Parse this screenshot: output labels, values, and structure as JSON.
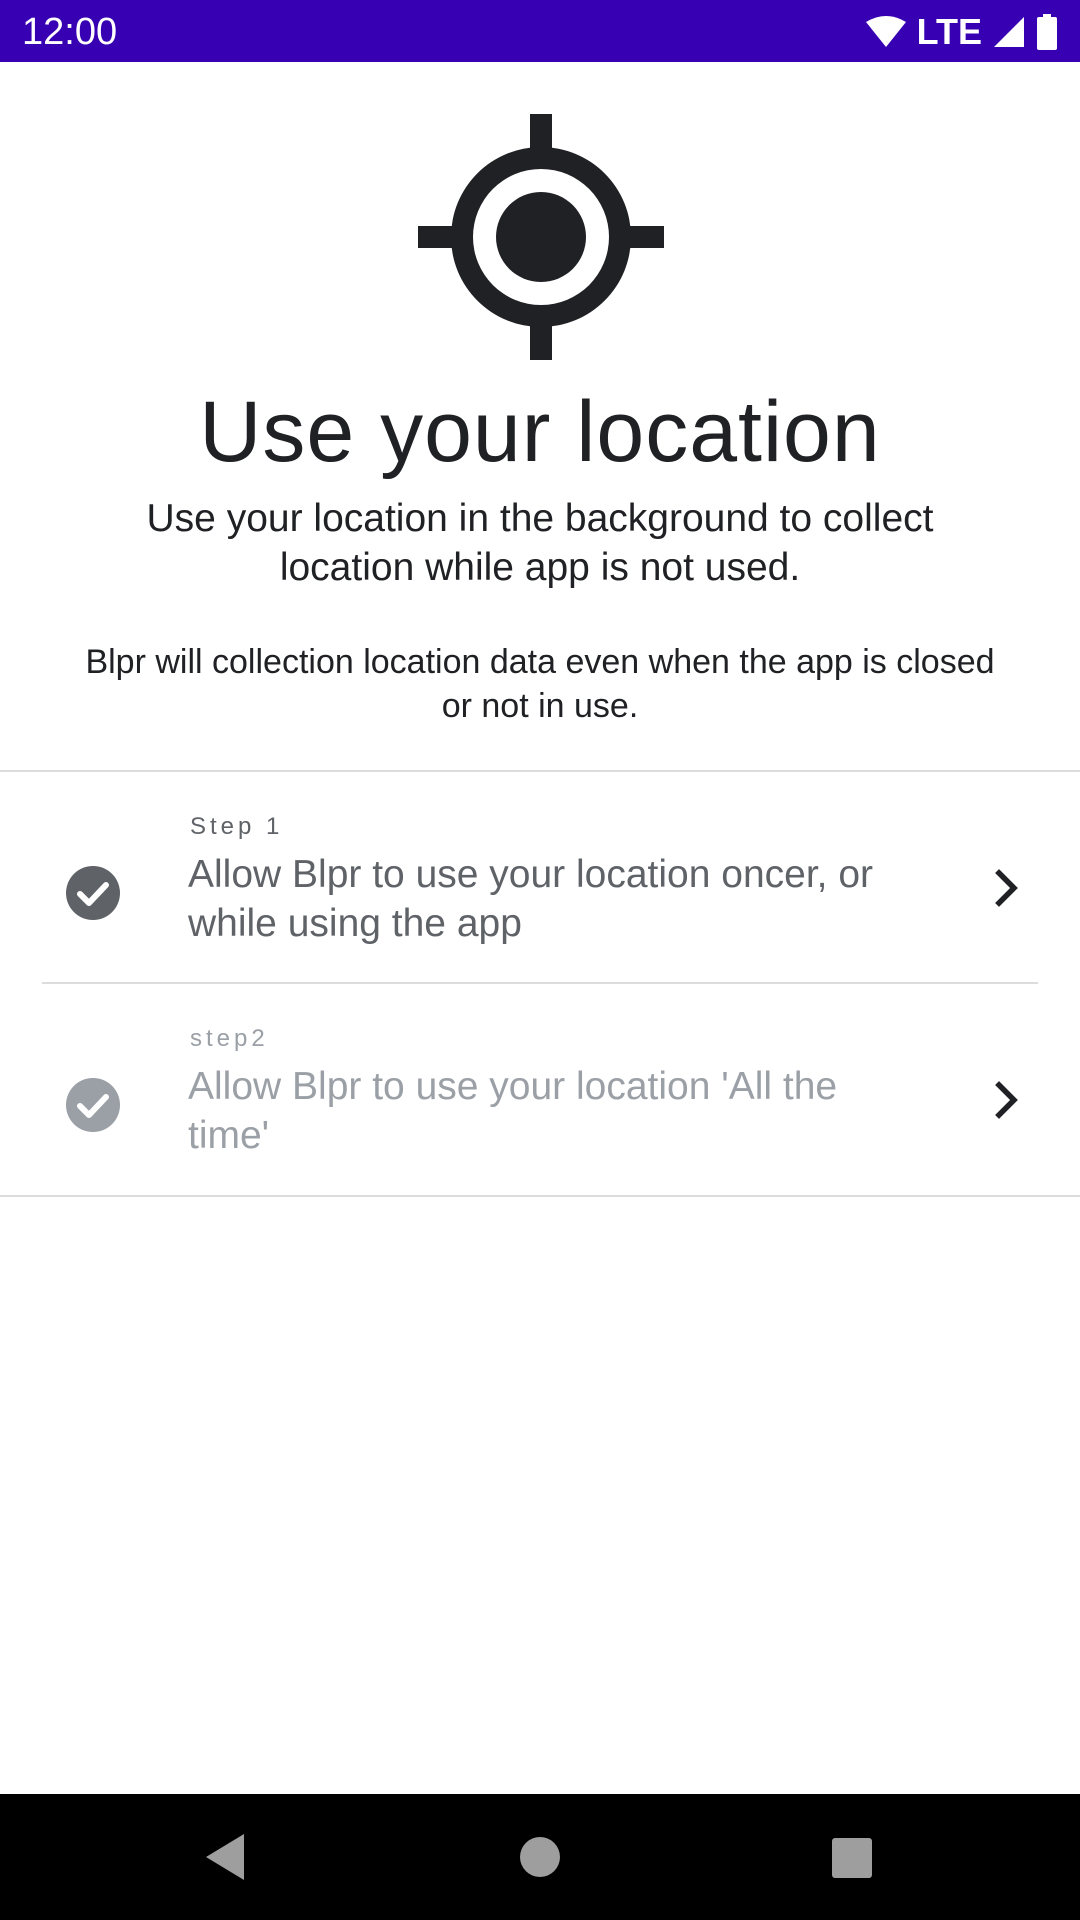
{
  "status_bar": {
    "time": "12:00",
    "network": "LTE",
    "icons": [
      "wifi-icon",
      "cell-signal-icon",
      "battery-icon"
    ],
    "background": "#3700b3"
  },
  "hero": {
    "icon": "location-crosshair-icon",
    "title": "Use your location",
    "subtitle": "Use your location in the background to collect location while app is not used.",
    "description": "Blpr will collection location data even when the app is closed or not in use."
  },
  "steps": [
    {
      "overline": "Step 1",
      "text": "Allow Blpr to use your location oncer, or while using the app",
      "icon": "check-circle-icon",
      "action_icon": "chevron-right-icon",
      "completed": true,
      "color": "#5f6368"
    },
    {
      "overline": "step2",
      "text": "Allow Blpr to use your location 'All the time'",
      "icon": "check-circle-icon",
      "action_icon": "chevron-right-icon",
      "completed": false,
      "color": "#9aa0a6"
    }
  ],
  "nav_bar": {
    "buttons": [
      "back-icon",
      "home-icon",
      "recents-icon"
    ]
  }
}
